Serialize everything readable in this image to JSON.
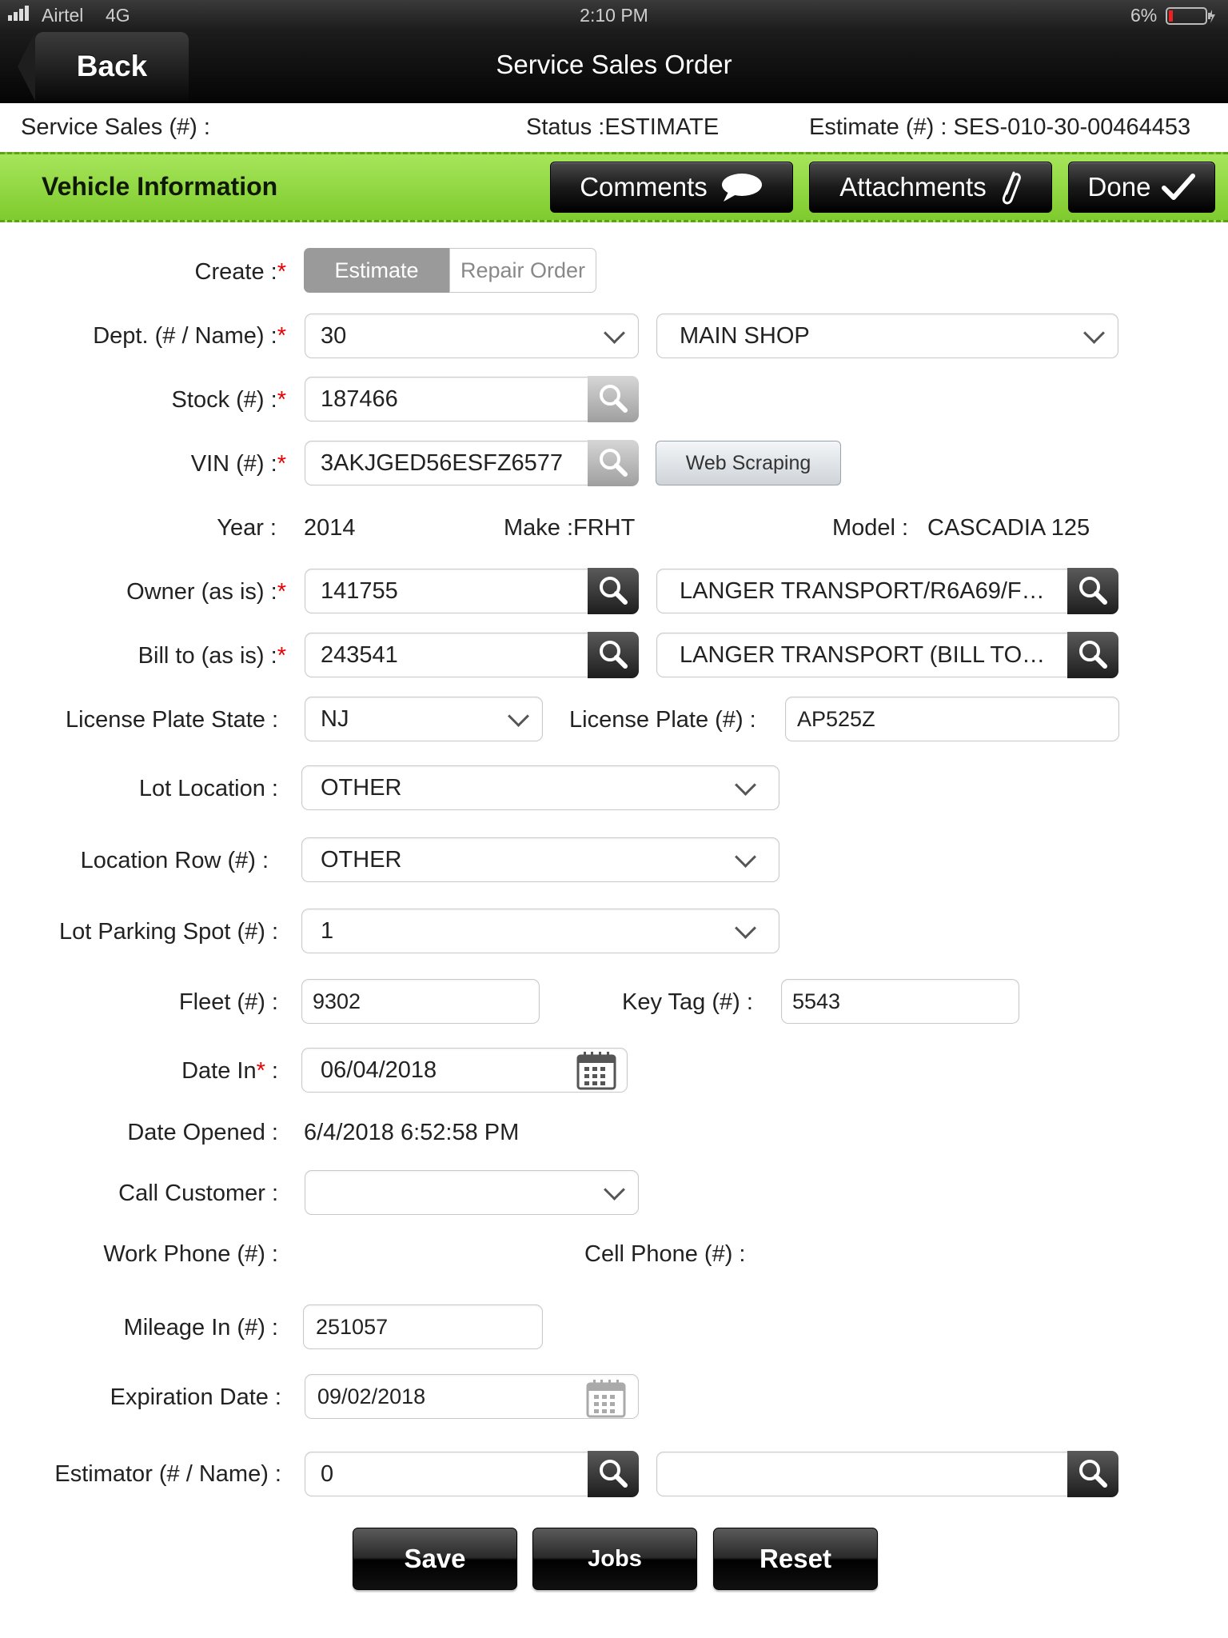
{
  "status_bar": {
    "carrier": "Airtel",
    "network": "4G",
    "time": "2:10 PM",
    "battery": "6%"
  },
  "nav": {
    "back_label": "Back",
    "title": "Service Sales Order"
  },
  "header": {
    "service_sales_label": "Service Sales (#)  :",
    "status_text": "Status :ESTIMATE",
    "estimate_text": "Estimate (#) :  SES-010-30-00464453"
  },
  "section": {
    "title": "Vehicle Information",
    "comments_label": "Comments",
    "attachments_label": "Attachments",
    "done_label": "Done"
  },
  "form": {
    "create_label": "Create  :",
    "create_options": [
      "Estimate",
      "Repair Order"
    ],
    "create_selected": "Estimate",
    "dept_label": "Dept. (# / Name)  :",
    "dept_number": "30",
    "dept_name": "MAIN SHOP",
    "stock_label": "Stock (#) :",
    "stock_value": "187466",
    "vin_label": "VIN (#) :",
    "vin_value": "3AKJGED56ESFZ6577",
    "web_scraping_label": "Web Scraping",
    "year_label": "Year :",
    "year_value": "2014",
    "make_text": "Make :FRHT",
    "model_label": "Model :",
    "model_value": "CASCADIA 125",
    "owner_label": "Owner (as is) :",
    "owner_number": "141755",
    "owner_name": "LANGER TRANSPORT/R6A69/F…",
    "billto_label": "Bill to (as is) :",
    "billto_number": "243541",
    "billto_name": "LANGER TRANSPORT (BILL TO…",
    "plate_state_label": "License Plate State :",
    "plate_state_value": "NJ",
    "plate_label": "License Plate (#) :",
    "plate_value": "AP525Z",
    "lot_location_label": "Lot Location :",
    "lot_location_value": "OTHER",
    "location_row_label": "Location Row (#) :",
    "location_row_value": "OTHER",
    "parking_spot_label": "Lot Parking Spot (#) :",
    "parking_spot_value": "1",
    "fleet_label": "Fleet (#) :",
    "fleet_value": "9302",
    "keytag_label": "Key Tag (#) :",
    "keytag_value": "5543",
    "date_in_label": "Date In",
    "date_in_colon": " :",
    "date_in_value": "06/04/2018",
    "date_opened_label": "Date Opened :",
    "date_opened_value": "6/4/2018 6:52:58 PM",
    "call_customer_label": "Call Customer :",
    "call_customer_value": "",
    "work_phone_label": "Work Phone (#) :",
    "cell_phone_label": "Cell Phone  (#) :",
    "mileage_label": "Mileage In (#) :",
    "mileage_value": "251057",
    "expiration_label": "Expiration Date :",
    "expiration_value": "09/02/2018",
    "estimator_label": "Estimator (# / Name) :",
    "estimator_number": "0",
    "estimator_name": ""
  },
  "buttons": {
    "save": "Save",
    "jobs": "Jobs",
    "reset": "Reset"
  }
}
